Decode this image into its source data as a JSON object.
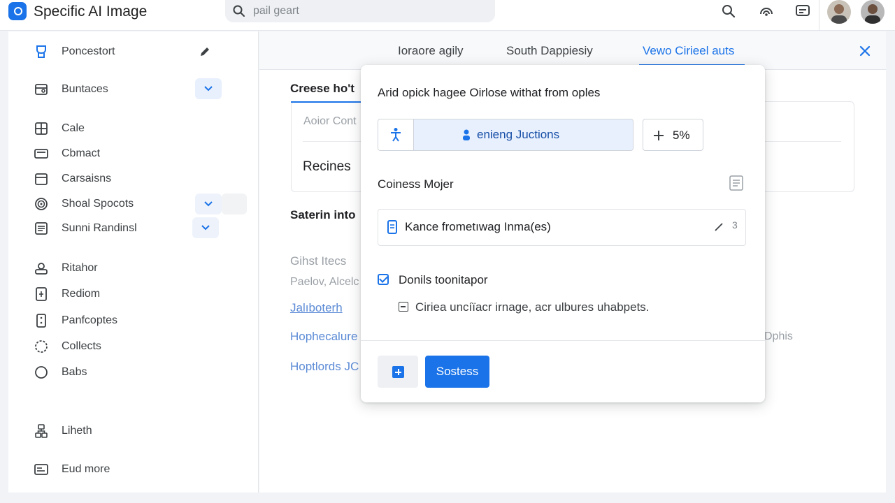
{
  "header": {
    "app_title": "Specific AI Image",
    "search_text": "pail geart"
  },
  "sidebar": {
    "items": [
      {
        "label": "Poncestort",
        "icon": "cup-icon"
      },
      {
        "label": "Buntaces",
        "icon": "folder-icon"
      },
      {
        "label": "Cale",
        "icon": "book-icon"
      },
      {
        "label": "Cbmact",
        "icon": "card-icon"
      },
      {
        "label": "Carsaisns",
        "icon": "calendar-icon"
      },
      {
        "label": "Shoal Spocots",
        "icon": "target-icon"
      },
      {
        "label": "Sunni Randinsl",
        "icon": "list-icon"
      },
      {
        "label": "Ritahor",
        "icon": "badge-icon"
      },
      {
        "label": "Rediom",
        "icon": "file-icon"
      },
      {
        "label": "Panfcoptes",
        "icon": "phone-icon"
      },
      {
        "label": "Collects",
        "icon": "collection-icon"
      },
      {
        "label": "Babs",
        "icon": "circle-icon"
      },
      {
        "label": "Liheth",
        "icon": "network-icon"
      },
      {
        "label": "Eud more",
        "icon": "more-icon"
      }
    ]
  },
  "tabs": [
    {
      "label": "Ioraore agily"
    },
    {
      "label": "South Dappiesiy"
    },
    {
      "label": "Vewo Cirieel auts"
    }
  ],
  "background": {
    "card_title": "Creese ho't",
    "card_placeholder": "Aoior Cont",
    "card_field": "Recines",
    "section_title": "Saterin into",
    "list_header": "Gihst Itecs",
    "list_sub": "Paelov, Alcelc",
    "link_1": "Jalıboterh",
    "link_2": "Hophecalure",
    "link_3": "Hoptlords JC",
    "side_text": "Dphis"
  },
  "dialog": {
    "heading": "Arid opick hagee Oirlose withat from oples",
    "segment_label": "enieng Juctions",
    "percent": "5%",
    "section_label": "Coiness Mojer",
    "field_text": "Kance frometıwag Inma(es)",
    "field_count": "3",
    "checkbox_label": "Donils toonitapor",
    "checkbox_checked": true,
    "sub_option": "Ciriea uncíïacr irnage, acr ulbures uhabpets.",
    "primary_button": "Sostess"
  },
  "colors": {
    "accent": "#1a73e8",
    "selected_bg": "#e8f0fe",
    "link": "#5c8bd6"
  }
}
